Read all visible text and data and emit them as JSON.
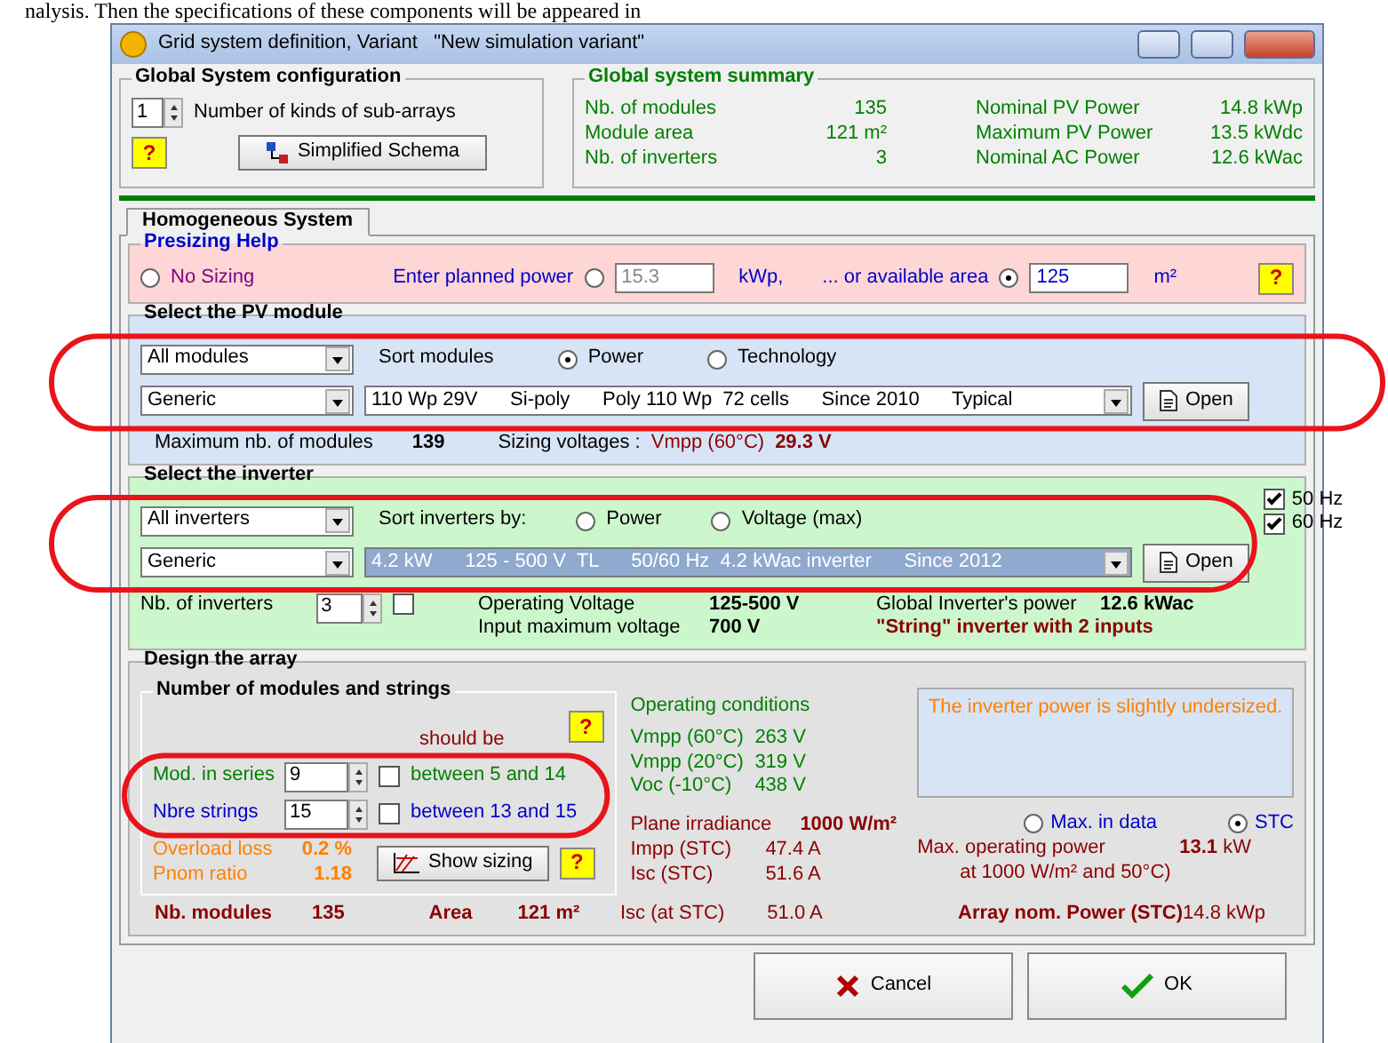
{
  "document_text": "nalysis. Then the specifications of these components will be appeared in",
  "window": {
    "title": "Grid system definition, Variant   \"New simulation variant\""
  },
  "global_config": {
    "title": "Global System configuration",
    "sub_arrays": "1",
    "sub_arrays_label": "Number of kinds of sub-arrays",
    "help": "?",
    "schema_button": "Simplified Schema"
  },
  "summary": {
    "title": "Global system summary",
    "rows": [
      {
        "label": "Nb. of modules",
        "value": "135",
        "label2": "Nominal PV Power",
        "value2": "14.8 kWp"
      },
      {
        "label": "Module area",
        "value": "121 m²",
        "label2": "Maximum PV Power",
        "value2": "13.5 kWdc"
      },
      {
        "label": "Nb. of inverters",
        "value": "3",
        "label2": "Nominal AC Power",
        "value2": "12.6 kWac"
      }
    ]
  },
  "tabs": [
    {
      "label": "Homogeneous System",
      "selected": true
    }
  ],
  "presizing": {
    "title": "Presizing Help",
    "help": "?",
    "options": [
      {
        "kind": "plain",
        "label": "No Sizing",
        "selected": false
      },
      {
        "kind": "input",
        "label": "Enter planned power",
        "selected": false,
        "value": "15.3",
        "unit": "kWp,"
      },
      {
        "kind": "input",
        "label": "... or available area",
        "selected": true,
        "value": "125",
        "unit": "m²"
      }
    ]
  },
  "pv_module": {
    "circled": true,
    "title": "Select the PV module",
    "filter": "All modules",
    "sort_label": "Sort modules",
    "sort_options": [
      {
        "label": "Power",
        "selected": true
      },
      {
        "label": "Technology",
        "selected": false
      }
    ],
    "manufacturer": "Generic",
    "model_fields": [
      "110 Wp 29V",
      "Si-poly",
      "Poly 110 Wp  72 cells",
      "Since 2010",
      "Typical"
    ],
    "open": "Open",
    "max_label": "Maximum nb. of modules",
    "max_value": "139",
    "sizing_label": "Sizing voltages :",
    "vmpp_label": "Vmpp (60°C)",
    "vmpp_value": "29.3 V"
  },
  "inverter": {
    "circled": true,
    "title": "Select the inverter",
    "filter": "All inverters",
    "sort_label": "Sort inverters by:",
    "sort_options": [
      {
        "label": "Power",
        "selected": false
      },
      {
        "label": "Voltage (max)",
        "selected": false
      }
    ],
    "frequencies": [
      {
        "label": "50 Hz",
        "checked": true
      },
      {
        "label": "60 Hz",
        "checked": true
      }
    ],
    "manufacturer": "Generic",
    "model_fields": [
      "4.2 kW",
      "125 - 500 V  TL",
      "50/60 Hz  4.2 kWac inverter",
      "Since 2012"
    ],
    "open": "Open",
    "count_label": "Nb. of inverters",
    "count": "3",
    "extra_checked": false,
    "specs": [
      {
        "label": "Operating Voltage",
        "value": "125-500 V",
        "label2": "Global Inverter's power",
        "value2": "12.6 kWac"
      },
      {
        "label": "Input maximum voltage",
        "value": "700 V",
        "note": "\"String\" inverter with 2 inputs"
      }
    ]
  },
  "array": {
    "strings_circled": true,
    "title": "Design the array",
    "group_title": "Number of modules and strings",
    "help": "?",
    "should_be": "should be",
    "rows": [
      {
        "label": "Mod. in series",
        "value": "9",
        "checked": false,
        "range": "between 5 and 14"
      },
      {
        "label": "Nbre strings",
        "value": "15",
        "checked": false,
        "range": "between 13 and 15"
      }
    ],
    "loss": [
      {
        "label": "Overload loss",
        "value": "0.2 %"
      },
      {
        "label": "Pnom ratio",
        "value": "1.18"
      }
    ],
    "show_sizing": "Show sizing",
    "help2": "?",
    "conditions_title": "Operating conditions",
    "conditions": [
      {
        "label": "Vmpp (60°C)",
        "value": "263 V"
      },
      {
        "label": "Vmpp (20°C)",
        "value": "319 V"
      },
      {
        "label": "Voc (-10°C)",
        "value": "438 V"
      }
    ],
    "irradiance": {
      "label": "Plane irradiance",
      "value": "1000 W/m²"
    },
    "currents": [
      {
        "label": "Impp (STC)",
        "value": "47.4 A"
      },
      {
        "label": "Isc (STC)",
        "value": "51.6 A"
      }
    ],
    "message": "The inverter power is slightly undersized.",
    "power_modes": [
      {
        "label": "Max. in data",
        "selected": false
      },
      {
        "label": "STC",
        "selected": true
      }
    ],
    "max_power": {
      "label": "Max. operating power",
      "sublabel": "at 1000 W/m² and 50°C)",
      "value": "13.1",
      "unit": "kW"
    },
    "totals": [
      {
        "label": "Nb. modules",
        "value": "135"
      },
      {
        "label": "Area",
        "value": "121 m²"
      }
    ],
    "isc_total": {
      "label": "Isc (at STC)",
      "value": "51.0 A"
    },
    "nominal": {
      "label": "Array nom. Power (STC)",
      "value": "14.8 kWp"
    }
  },
  "buttons": [
    {
      "kind": "cancel",
      "label": "Cancel"
    },
    {
      "kind": "ok",
      "label": "OK"
    }
  ]
}
